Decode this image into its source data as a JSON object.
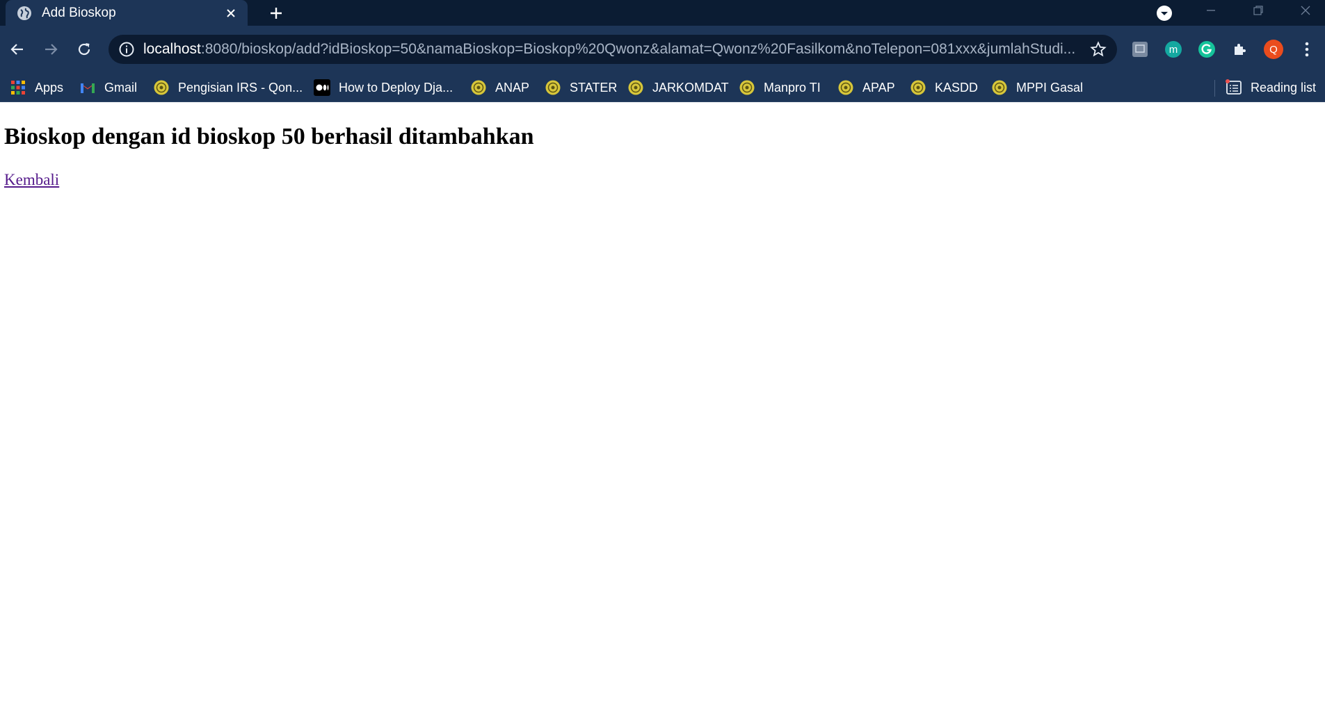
{
  "tab": {
    "title": "Add Bioskop"
  },
  "address_bar": {
    "host": "localhost",
    "path": ":8080/bioskop/add?idBioskop=50&namaBioskop=Bioskop%20Qwonz&alamat=Qwonz%20Fasilkom&noTelepon=081xxx&jumlahStudi..."
  },
  "profile": {
    "initial": "Q"
  },
  "bookmarks": [
    {
      "label": "Apps",
      "icon": "apps-grid-icon"
    },
    {
      "label": "Gmail",
      "icon": "gmail-icon"
    },
    {
      "label": "Pengisian IRS - Qon...",
      "icon": "ui-logo-icon"
    },
    {
      "label": "How to Deploy Dja...",
      "icon": "medium-icon"
    },
    {
      "label": "ANAP",
      "icon": "ui-logo-icon"
    },
    {
      "label": "STATER",
      "icon": "ui-logo-icon"
    },
    {
      "label": "JARKOMDAT",
      "icon": "ui-logo-icon"
    },
    {
      "label": "Manpro TI",
      "icon": "ui-logo-icon"
    },
    {
      "label": "APAP",
      "icon": "ui-logo-icon"
    },
    {
      "label": "KASDD",
      "icon": "ui-logo-icon"
    },
    {
      "label": "MPPI Gasal",
      "icon": "ui-logo-icon"
    }
  ],
  "reading_list": {
    "label": "Reading list"
  },
  "page": {
    "heading": "Bioskop dengan id bioskop 50 berhasil ditambahkan",
    "back_link": "Kembali"
  },
  "colors": {
    "tab_strip": "#0b1c33",
    "toolbar": "#1d3557",
    "link_visited": "#551a8b",
    "profile_badge": "#ea4c1d"
  }
}
